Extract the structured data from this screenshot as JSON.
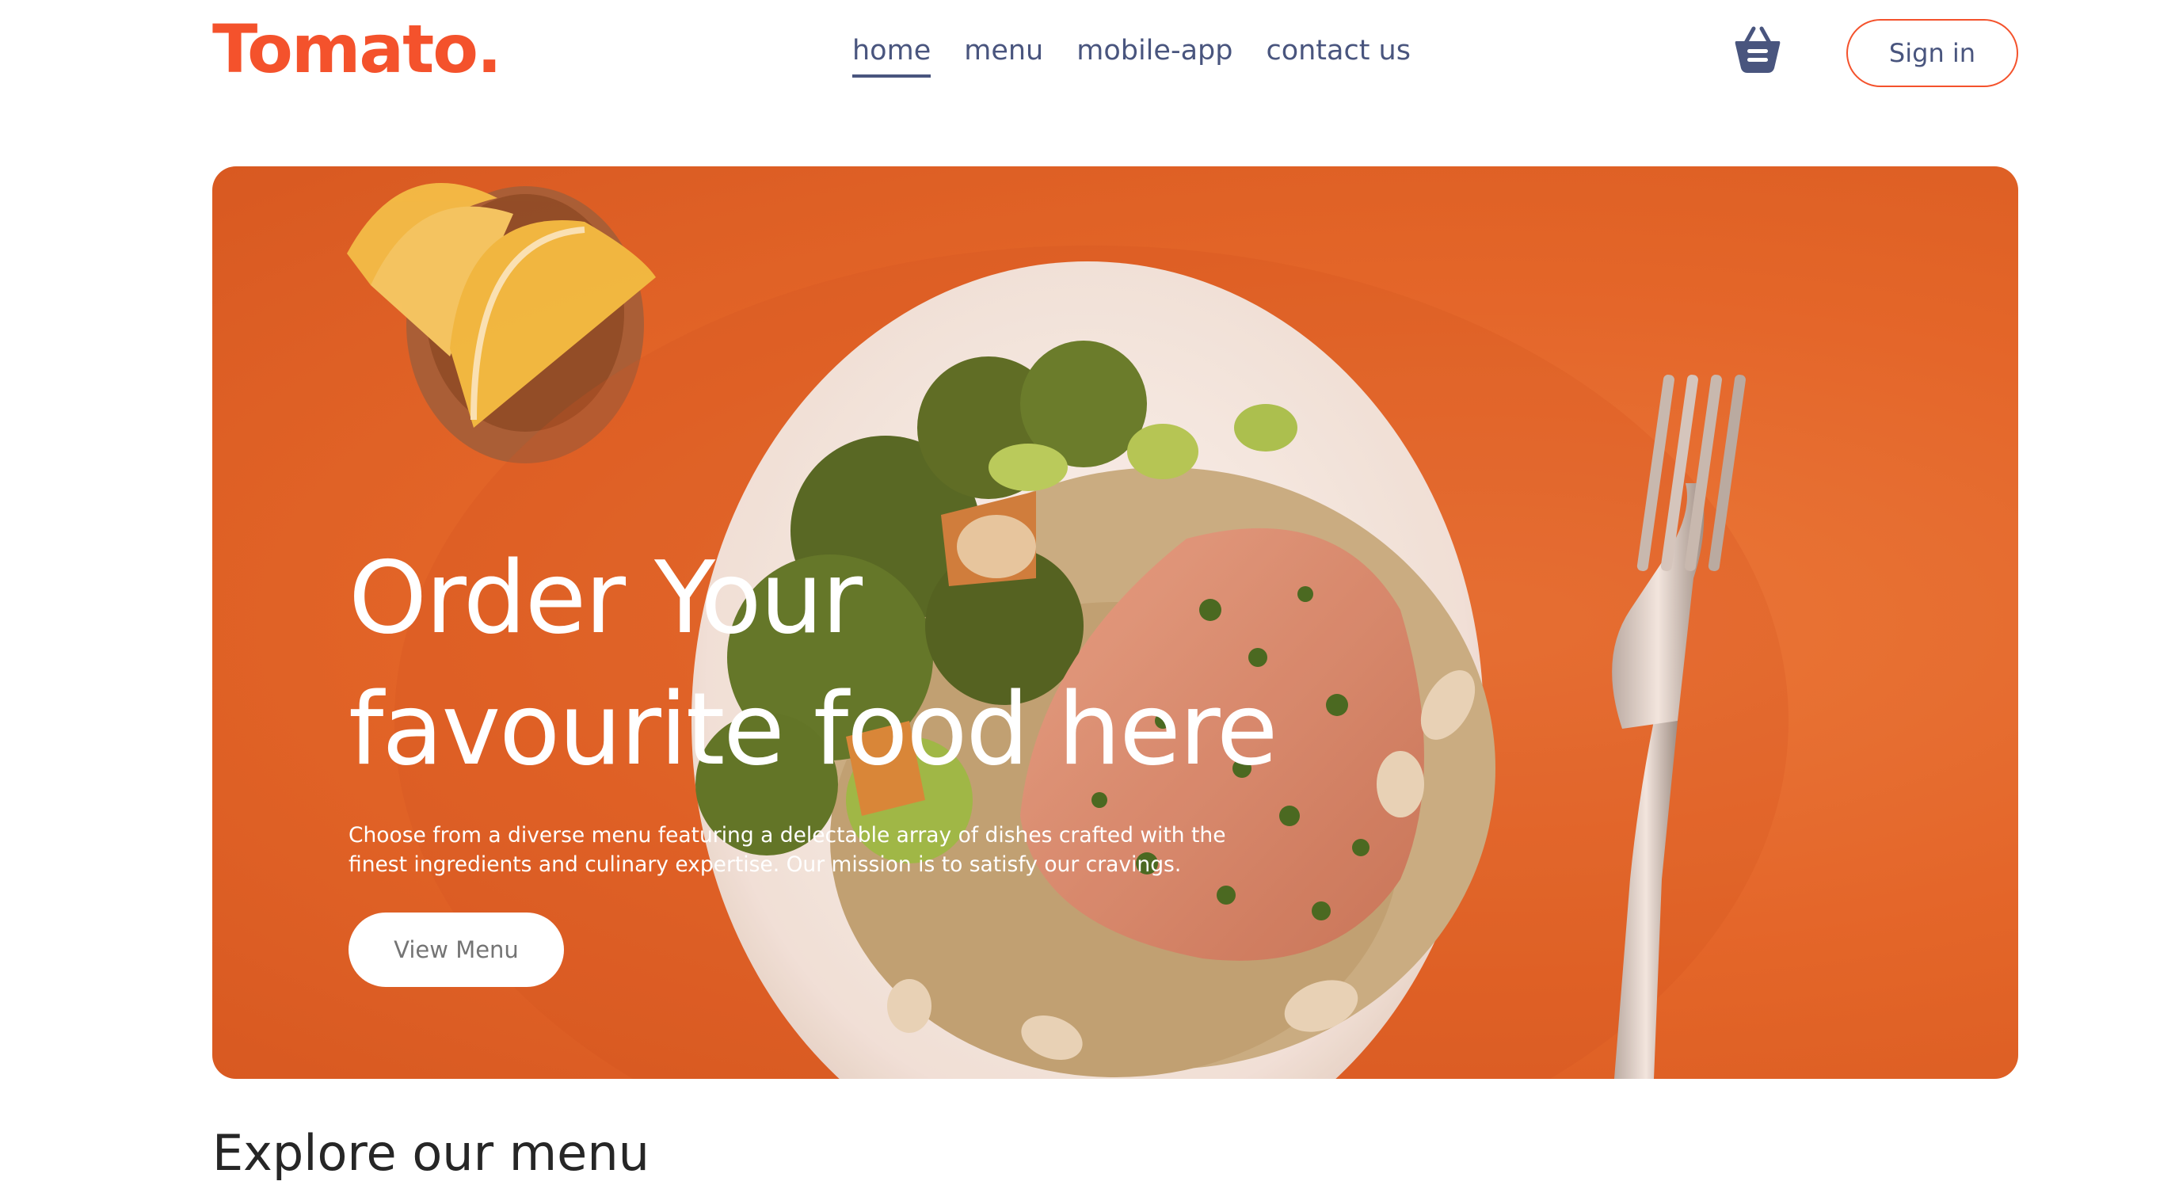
{
  "navbar": {
    "logo": "Tomato.",
    "links": [
      {
        "label": "home",
        "active": true
      },
      {
        "label": "menu",
        "active": false
      },
      {
        "label": "mobile-app",
        "active": false
      },
      {
        "label": "contact us",
        "active": false
      }
    ],
    "cart_icon": "basket-icon",
    "signin_label": "Sign in"
  },
  "hero": {
    "title_line1": "Order Your",
    "title_line2": "favourite food here",
    "description": "Choose from a diverse menu featuring a delectable array of dishes crafted with the finest ingredients and culinary expertise. Our mission is to satisfy our cravings.",
    "cta_label": "View Menu",
    "background_image": "salmon-quinoa-broccoli-plate-on-orange"
  },
  "explore": {
    "title": "Explore our menu"
  },
  "colors": {
    "brand": "#f4522c",
    "nav_text": "#49557e",
    "hero_bg": "#e4662a",
    "heading": "#262626"
  }
}
